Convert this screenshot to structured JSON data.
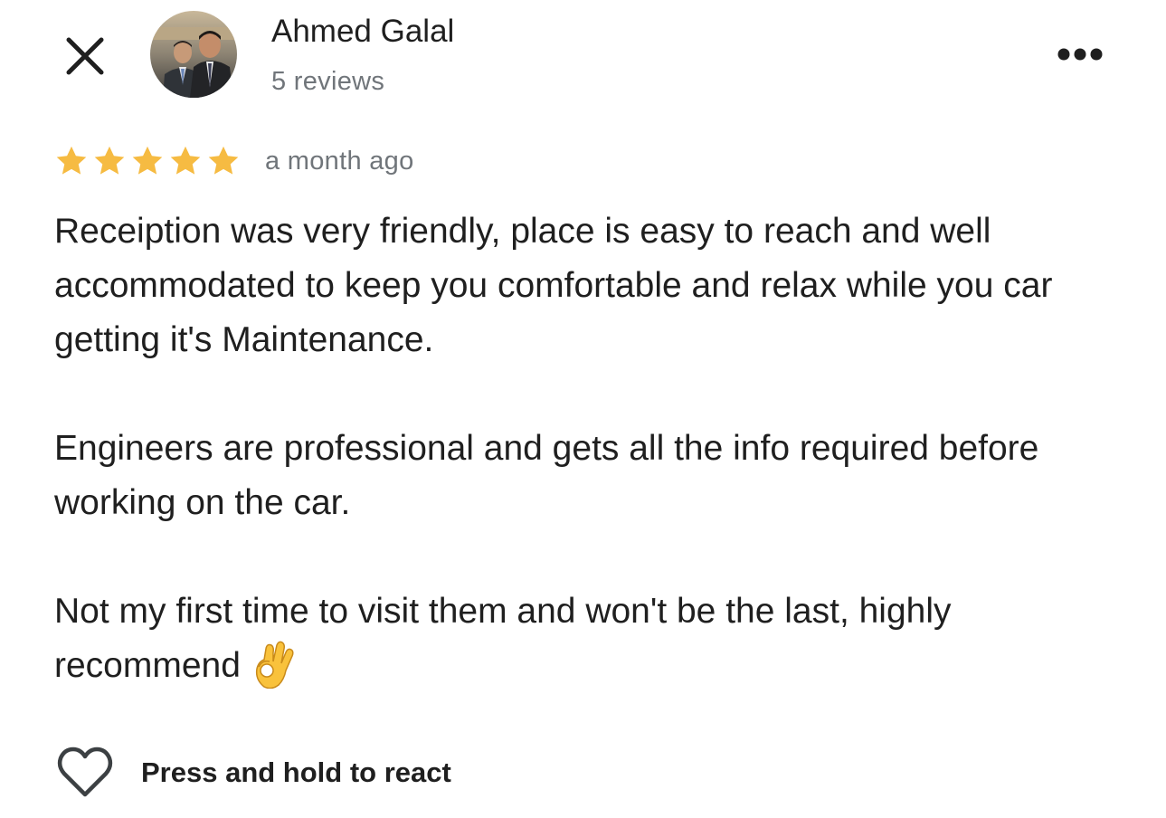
{
  "header": {
    "close_icon": "close-icon",
    "avatar_alt": "avatar",
    "reviewer_name": "Ahmed Galal",
    "review_count": "5 reviews",
    "more_icon": "more-horizontal-icon"
  },
  "review": {
    "rating": 5,
    "rating_max": 5,
    "star_color": "#f6bb42",
    "date": "a month ago",
    "paragraphs": [
      "Receiption was very friendly, place is easy to reach and well accommodated to keep you comfortable and relax while you car getting it's Maintenance.",
      "Engineers are professional and gets all the info required before working on the car.",
      "Not my first time to visit them and won't be the last, highly recommend"
    ],
    "emoji": "ok-hand-emoji"
  },
  "footer": {
    "react_icon": "heart-outline-icon",
    "react_label": "Press and hold to react"
  }
}
